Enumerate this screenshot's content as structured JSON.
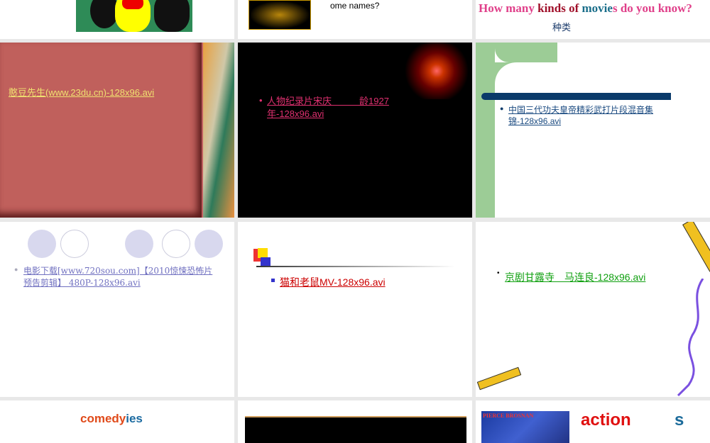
{
  "slides": [
    {
      "id": "mickey"
    },
    {
      "text": "some of them. Can you give s ome names?"
    },
    {
      "title_parts": [
        "How many ",
        "kinds of ",
        "movie",
        "s",
        " do you know?"
      ],
      "subtitle": "种类"
    },
    {
      "link": "憨豆先生(www.23du.cn)-128x96.avi"
    },
    {
      "link": "人物纪录片宋庆　　　龄1927年-128x96.avi"
    },
    {
      "link": "中国三代功夫皇帝精彩武打片段混音集锦-128x96.avi"
    },
    {
      "link": "电影下载[www.720sou.com]【2010惊悚恐怖片预告剪辑】 480P-128x96.avi"
    },
    {
      "link": "猫和老鼠MV-128x96.avi"
    },
    {
      "link": "京剧甘露寺　马连良-128x96.avi"
    },
    {
      "title_a": "comedy",
      "title_b": "ies"
    },
    {
      "id": "black"
    },
    {
      "poster": "PIERCE BROSNAN",
      "title_a": "action",
      "title_b": "s"
    }
  ]
}
